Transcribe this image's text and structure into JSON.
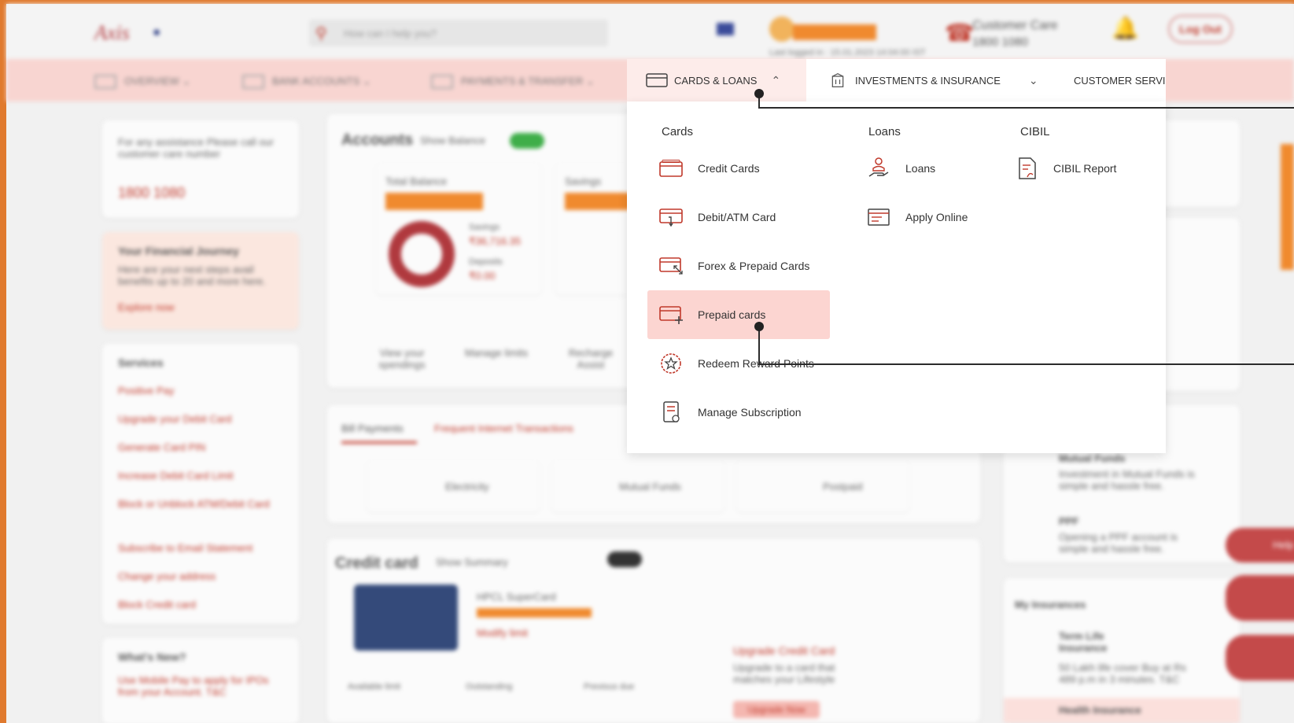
{
  "blurred_bg": {
    "search_placeholder": "How can I help you?",
    "last_login": "Last logged in : 15.01.2023 14:04:00 IST",
    "customer_care_title": "Customer Care",
    "customer_care_number": "1800 1080",
    "logout_label": "Log Out",
    "menu": [
      "OVERVIEW",
      "BANK ACCOUNTS",
      "PAYMENTS & TRANSFER"
    ],
    "assist_text": "For any assistance Please call our customer care number",
    "assist_phone": "1800 1080",
    "journey_title": "Your Financial Journey",
    "journey_text": "Here are your next steps avail benefits up to 20 and more here.",
    "journey_link": "Explore now",
    "services_title": "Services",
    "services": [
      "Positive Pay",
      "Upgrade your Debit Card",
      "Generate Card PIN",
      "Increase Debit Card Limit",
      "Block or Unblock ATM/Debit Card",
      "Subscribe to Email Statement",
      "Change your address",
      "Block Credit card"
    ],
    "whats_new": "What's New?",
    "whats_new_text": "Use Mobile Pay to apply for IPOs from your Account. T&C",
    "accounts_title": "Accounts",
    "show_balance": "Show Balance",
    "total_balance": "Total Balance",
    "savings_label": "Savings",
    "savings_value": "₹36,716.35",
    "deposits_label": "Deposits",
    "deposits_value": "₹0.00",
    "quick_links": [
      "View your spendings",
      "Manage limits",
      "Recharge Assist"
    ],
    "bill_tabs": [
      "Bill Payments",
      "Frequent Internet Transactions"
    ],
    "bills": [
      "Electricity",
      "Mutual Funds",
      "Postpaid"
    ],
    "credit_card_title": "Credit card",
    "show_summary": "Show Summary",
    "card_name": "HPCL SuperCard",
    "modify_limit": "Modify limit",
    "card_cols": [
      "Available limit",
      "Outstanding",
      "Previous due"
    ],
    "upgrade_title": "Upgrade Credit Card",
    "upgrade_text": "Upgrade to a card that matches your Lifestyle",
    "upgrade_btn": "Upgrade Now",
    "mutual_funds": "Mutual Funds",
    "mutual_funds_text": "Investment in Mutual Funds is simple and hassle free.",
    "ppf": "PPF",
    "ppf_text": "Opening a PPF account is simple and hassle free.",
    "my_insurances": "My Insurances",
    "term_life": "Term Life Insurance",
    "term_life_text": "50 Lakh life cover Buy at Rs 489 p.m in 3 minutes. T&C",
    "health_insurance": "Health Insurance",
    "help_btn": "Help"
  },
  "nav": {
    "cards_loans": "CARDS & LOANS",
    "investments": "INVESTMENTS & INSURANCE",
    "customer_service": "CUSTOMER SERVICE"
  },
  "dropdown": {
    "cards_heading": "Cards",
    "loans_heading": "Loans",
    "cibil_heading": "CIBIL",
    "cards": [
      {
        "label": "Credit Cards",
        "icon": "credit-card-icon"
      },
      {
        "label": "Debit/ATM Card",
        "icon": "debit-card-icon"
      },
      {
        "label": "Forex & Prepaid Cards",
        "icon": "forex-card-icon"
      },
      {
        "label": "Prepaid cards",
        "icon": "prepaid-card-icon"
      },
      {
        "label": "Redeem Reward Points",
        "icon": "reward-star-icon"
      },
      {
        "label": "Manage Subscription",
        "icon": "subscription-icon"
      }
    ],
    "loans": [
      {
        "label": "Loans",
        "icon": "loan-hand-icon"
      },
      {
        "label": "Apply Online",
        "icon": "apply-form-icon"
      }
    ],
    "cibil": [
      {
        "label": "CIBIL Report",
        "icon": "report-icon"
      }
    ]
  },
  "colors": {
    "accent_orange": "#e07a2e",
    "brand_red": "#c0392b",
    "menu_bg": "#f8d5d1",
    "highlight": "#fcd5d1"
  }
}
